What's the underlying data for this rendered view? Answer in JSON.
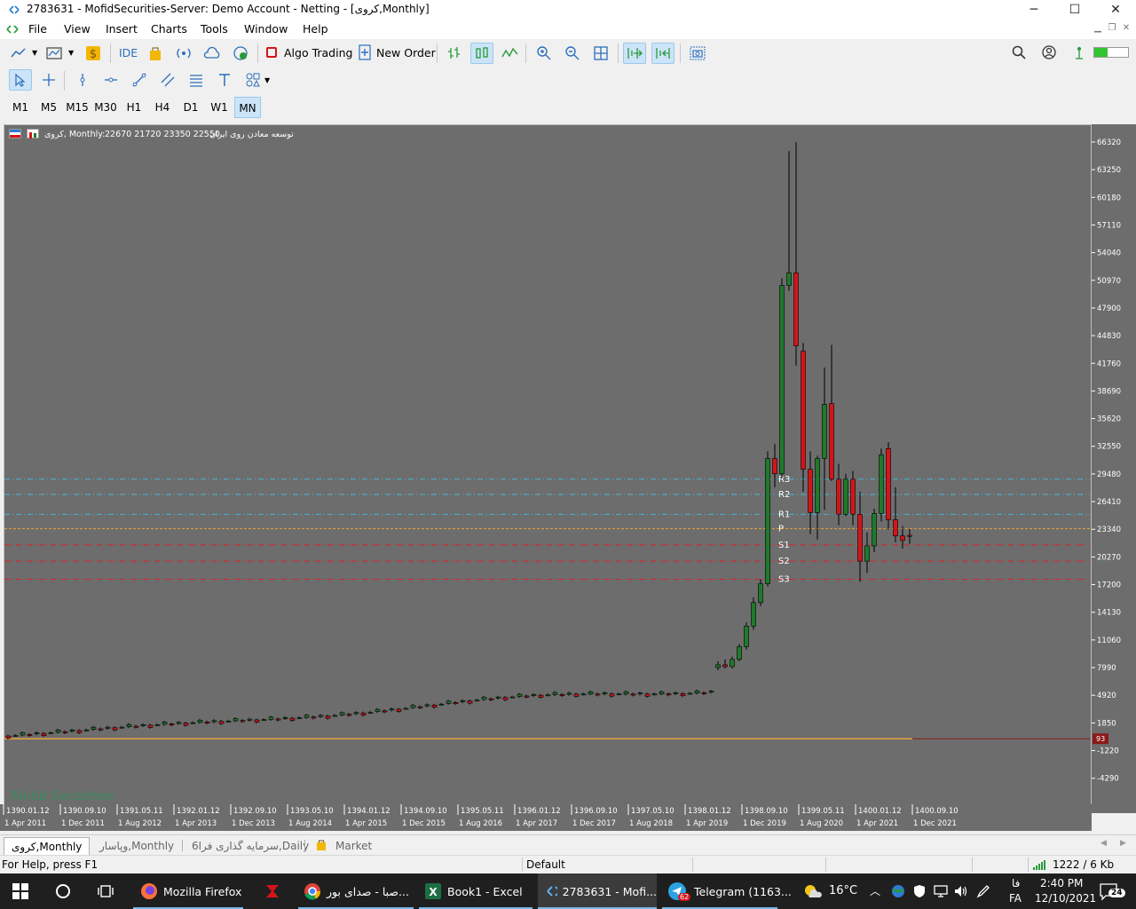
{
  "window": {
    "title": "2783631 - MofidSecurities-Server: Demo Account - Netting - [کروی,Monthly]",
    "minimize": "─",
    "maximize": "☐",
    "close": "✕"
  },
  "menu": [
    "File",
    "View",
    "Insert",
    "Charts",
    "Tools",
    "Window",
    "Help"
  ],
  "toolbar": {
    "ide_label": "IDE",
    "algo_trading_label": "Algo Trading",
    "new_order_label": "New Order",
    "signal_bars_percent": 40
  },
  "timeframes": [
    "M1",
    "M5",
    "M15",
    "M30",
    "H1",
    "H4",
    "D1",
    "W1",
    "MN"
  ],
  "active_timeframe": "MN",
  "chart": {
    "header_symbol": "کروی, Monthly:",
    "header_ohlc": "22670 21720 23350 22550",
    "header_name": "توسعه معادن روی ایران",
    "watermark": "Mofid Securities",
    "current_price_label": "93",
    "pivot_labels": [
      "R3",
      "R2",
      "R1",
      "P",
      "S1",
      "S2",
      "S3"
    ],
    "colors": {
      "background": "#6d6d6d",
      "bull": "#1f7a2b",
      "bear": "#d4141a",
      "pivot_resistance": "#46b6d8",
      "pivot_point": "#e8a33a",
      "pivot_support": "#e0202a"
    }
  },
  "chart_data": {
    "type": "candlestick",
    "title": "کروی, Monthly",
    "y_ticks": [
      66320,
      63250,
      60180,
      57110,
      54040,
      50970,
      47900,
      44830,
      41760,
      38690,
      35620,
      32550,
      29480,
      26410,
      23340,
      20270,
      17200,
      14130,
      11060,
      7990,
      4920,
      1850,
      -1220,
      -4290
    ],
    "ylim": [
      -5600,
      67300
    ],
    "x_ticks_persian": [
      "1390.01.12",
      "1390.09.10",
      "1391.05.11",
      "1392.01.12",
      "1392.09.10",
      "1393.05.10",
      "1394.01.12",
      "1394.09.10",
      "1395.05.11",
      "1396.01.12",
      "1396.09.10",
      "1397.05.10",
      "1398.01.12",
      "1398.09.10",
      "1399.05.11",
      "1400.01.12",
      "1400.09.10"
    ],
    "x_ticks_gregorian": [
      "1 Apr 2011",
      "1 Dec 2011",
      "1 Aug 2012",
      "1 Apr 2013",
      "1 Dec 2013",
      "1 Aug 2014",
      "1 Apr 2015",
      "1 Dec 2015",
      "1 Aug 2016",
      "1 Apr 2017",
      "1 Dec 2017",
      "1 Aug 2018",
      "1 Apr 2019",
      "1 Dec 2019",
      "1 Aug 2020",
      "1 Apr 2021",
      "1 Dec 2021"
    ],
    "pivot_levels": {
      "R3": 28900,
      "R2": 27200,
      "R1": 25000,
      "P": 23400,
      "S1": 21600,
      "S2": 19800,
      "S3": 17800
    },
    "current_price": 93,
    "candles": [
      {
        "date": "2019-08",
        "o": 8000,
        "h": 8700,
        "l": 7700,
        "c": 8300
      },
      {
        "date": "2019-09",
        "o": 8300,
        "h": 8900,
        "l": 7900,
        "c": 8100
      },
      {
        "date": "2019-10",
        "o": 8100,
        "h": 9200,
        "l": 7900,
        "c": 8900
      },
      {
        "date": "2019-11",
        "o": 8900,
        "h": 10600,
        "l": 8700,
        "c": 10300
      },
      {
        "date": "2019-12",
        "o": 10300,
        "h": 13000,
        "l": 10000,
        "c": 12600
      },
      {
        "date": "2020-01",
        "o": 12600,
        "h": 15800,
        "l": 12200,
        "c": 15200
      },
      {
        "date": "2020-02",
        "o": 15200,
        "h": 17800,
        "l": 14800,
        "c": 17300
      },
      {
        "date": "2020-03",
        "o": 17300,
        "h": 32000,
        "l": 17000,
        "c": 31200
      },
      {
        "date": "2020-04",
        "o": 31200,
        "h": 32800,
        "l": 28000,
        "c": 29500
      },
      {
        "date": "2020-05",
        "o": 29500,
        "h": 51200,
        "l": 29000,
        "c": 50400
      },
      {
        "date": "2020-06",
        "o": 50400,
        "h": 65300,
        "l": 49800,
        "c": 51800
      },
      {
        "date": "2020-07",
        "o": 51800,
        "h": 66300,
        "l": 41500,
        "c": 43700
      },
      {
        "date": "2020-08",
        "o": 43100,
        "h": 44000,
        "l": 27500,
        "c": 30000
      },
      {
        "date": "2020-09",
        "o": 30000,
        "h": 32000,
        "l": 22800,
        "c": 25200
      },
      {
        "date": "2020-10",
        "o": 25200,
        "h": 31500,
        "l": 22200,
        "c": 31200
      },
      {
        "date": "2020-11",
        "o": 31200,
        "h": 41300,
        "l": 25500,
        "c": 37200
      },
      {
        "date": "2020-12",
        "o": 37300,
        "h": 43800,
        "l": 28700,
        "c": 28900
      },
      {
        "date": "2021-01",
        "o": 28900,
        "h": 30600,
        "l": 23800,
        "c": 25000
      },
      {
        "date": "2021-02",
        "o": 25000,
        "h": 29500,
        "l": 24800,
        "c": 28900
      },
      {
        "date": "2021-03",
        "o": 28900,
        "h": 29800,
        "l": 23800,
        "c": 25000
      },
      {
        "date": "2021-04",
        "o": 25000,
        "h": 27500,
        "l": 17500,
        "c": 19800
      },
      {
        "date": "2021-05",
        "o": 19800,
        "h": 23000,
        "l": 18500,
        "c": 21500
      },
      {
        "date": "2021-06",
        "o": 21500,
        "h": 25600,
        "l": 20800,
        "c": 25100
      },
      {
        "date": "2021-07",
        "o": 25100,
        "h": 32300,
        "l": 24200,
        "c": 31600
      },
      {
        "date": "2021-08",
        "o": 32300,
        "h": 33000,
        "l": 23300,
        "c": 24400
      },
      {
        "date": "2021-09",
        "o": 24400,
        "h": 28000,
        "l": 21900,
        "c": 22600
      },
      {
        "date": "2021-10",
        "o": 22600,
        "h": 23700,
        "l": 21200,
        "c": 22100
      },
      {
        "date": "2021-11",
        "o": 22670,
        "h": 23350,
        "l": 21720,
        "c": 22550
      }
    ]
  },
  "tabs": [
    {
      "label": "کروی,Monthly",
      "active": true
    },
    {
      "label": "وپاسار,Monthly",
      "active": false
    },
    {
      "label": "سرمایه گذاری فرا6,Daily",
      "active": false
    },
    {
      "label": "Market",
      "active": false
    }
  ],
  "status": {
    "help": "For Help, press F1",
    "profile": "Default",
    "connection": "1222 / 6 Kb"
  },
  "taskbar": {
    "items": [
      {
        "label": "Mozilla Firefox"
      },
      {
        "label": ""
      },
      {
        "label": "صبا - صدای بور..."
      },
      {
        "label": "Book1 - Excel"
      },
      {
        "label": "2783631 - Mofi..."
      },
      {
        "label": "Telegram (1163..."
      }
    ],
    "telegram_badge": "62",
    "weather": "16°C",
    "lang_top": "فا",
    "lang_bottom": "FA",
    "time": "2:40 PM",
    "date": "12/10/2021",
    "notif": "24"
  }
}
